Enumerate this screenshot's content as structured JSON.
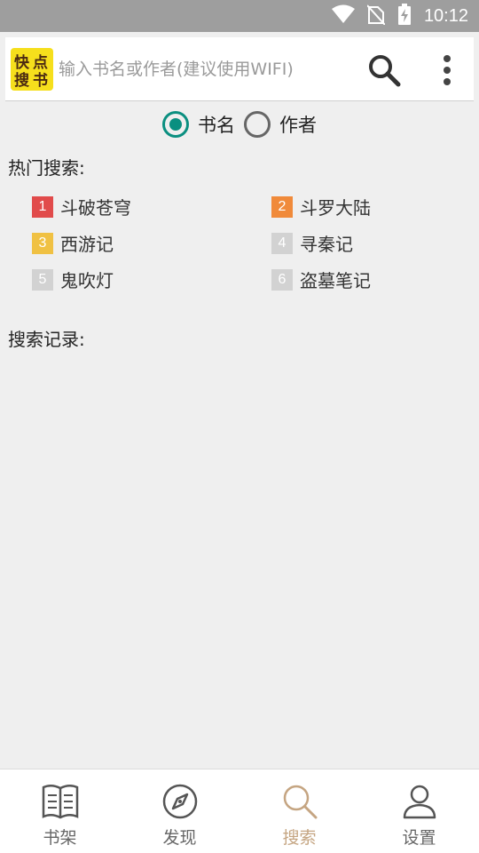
{
  "status_bar": {
    "time": "10:12"
  },
  "search": {
    "logo_text": "快点搜书",
    "placeholder": "输入书名或作者(建议使用WIFI)",
    "value": ""
  },
  "mode": {
    "options": [
      {
        "label": "书名",
        "checked": true
      },
      {
        "label": "作者",
        "checked": false
      }
    ]
  },
  "hot": {
    "title": "热门搜索:",
    "items": [
      {
        "rank": "1",
        "title": "斗破苍穹",
        "color": "#e14b4b"
      },
      {
        "rank": "2",
        "title": "斗罗大陆",
        "color": "#f08a3a"
      },
      {
        "rank": "3",
        "title": "西游记",
        "color": "#f0c143"
      },
      {
        "rank": "4",
        "title": "寻秦记",
        "color": "#d2d2d2"
      },
      {
        "rank": "5",
        "title": "鬼吹灯",
        "color": "#d2d2d2"
      },
      {
        "rank": "6",
        "title": "盗墓笔记",
        "color": "#d2d2d2"
      }
    ]
  },
  "history": {
    "title": "搜索记录:"
  },
  "nav": {
    "items": [
      {
        "label": "书架",
        "icon": "book-icon"
      },
      {
        "label": "发现",
        "icon": "compass-icon"
      },
      {
        "label": "搜索",
        "icon": "search-icon",
        "active": true
      },
      {
        "label": "设置",
        "icon": "person-icon"
      }
    ],
    "active_color": "#c5a582"
  }
}
